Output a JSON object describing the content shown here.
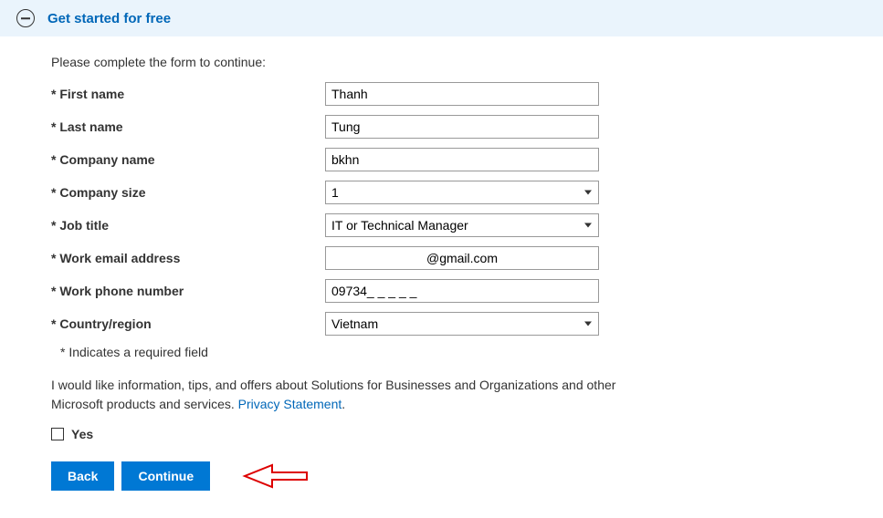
{
  "banner": {
    "title": "Get started for free"
  },
  "instruction": "Please complete the form to continue:",
  "fields": {
    "first_name": {
      "label": "* First name",
      "value": "Thanh"
    },
    "last_name": {
      "label": "* Last name",
      "value": "Tung"
    },
    "company_name": {
      "label": "* Company name",
      "value": "bkhn"
    },
    "company_size": {
      "label": "* Company size",
      "value": "1"
    },
    "job_title": {
      "label": "* Job title",
      "value": "IT or Technical Manager"
    },
    "work_email": {
      "label": "* Work email address",
      "value": "@gmail.com"
    },
    "work_phone": {
      "label": "* Work phone number",
      "value": "09734_ _ _ _ _"
    },
    "country": {
      "label": "* Country/region",
      "value": "Vietnam"
    }
  },
  "required_note": "* Indicates a required field",
  "consent_text_1": "I would like information, tips, and offers about Solutions for Businesses and Organizations and other Microsoft products and services. ",
  "privacy_link": "Privacy Statement",
  "consent_period": ".",
  "checkbox": {
    "label": "Yes"
  },
  "buttons": {
    "back": "Back",
    "continue": "Continue"
  }
}
